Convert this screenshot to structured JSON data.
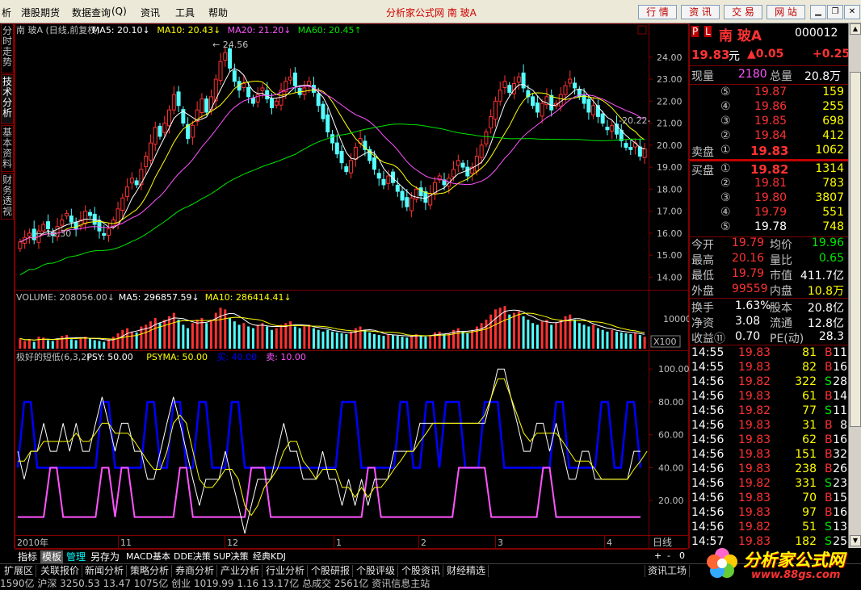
{
  "menu": {
    "items": [
      "析",
      "港股期货",
      "数据查询",
      "资讯",
      "工具",
      "帮助"
    ],
    "shortcut": "(Q)",
    "title": "分析家公式网 南 玻A",
    "right_buttons": [
      "行 情",
      "资 讯",
      "交 易",
      "网 站"
    ]
  },
  "side_tabs": [
    "分时走势",
    "技术分析",
    "基本资料",
    "财务透视"
  ],
  "price_panel": {
    "legend": [
      {
        "text": "南 玻A (日线,前复权)",
        "color": "#c0c0c0"
      },
      {
        "text": "MA5: 20.10↓",
        "color": "#ffffff"
      },
      {
        "text": "MA10: 20.43↓",
        "color": "#ffff00"
      },
      {
        "text": "MA20: 21.20↓",
        "color": "#ff54ff"
      },
      {
        "text": "MA60: 20.45↑",
        "color": "#00e600"
      }
    ],
    "y_ticks": [
      "24.00",
      "23.00",
      "22.00",
      "21.00",
      "20.00",
      "19.00",
      "18.00",
      "17.00",
      "16.00",
      "15.00",
      "14.00"
    ],
    "high_label": "24.56",
    "low_label": "15.30",
    "last_label": "20.22"
  },
  "volume_panel": {
    "legend": [
      {
        "text": "VOLUME: 208056.00↓",
        "color": "#c0c0c0"
      },
      {
        "text": "MA5: 296857.59↓",
        "color": "#ffffff"
      },
      {
        "text": "MA10: 286414.41↓",
        "color": "#ffff00"
      }
    ],
    "y_tick": "10000",
    "unit": "X100"
  },
  "indicator_panel": {
    "legend": [
      {
        "text": "极好的短低(6,3,2)",
        "color": "#c0c0c0"
      },
      {
        "text": "PSY: 50.00",
        "color": "#ffffff"
      },
      {
        "text": "PSYMA: 50.00",
        "color": "#ffff00"
      },
      {
        "text": "买: 40.00",
        "color": "#0000ff"
      },
      {
        "text": "卖: 10.00",
        "color": "#ff54ff"
      }
    ],
    "y_ticks": [
      "100.00",
      "80.00",
      "60.00",
      "40.00",
      "20.00"
    ]
  },
  "x_axis": {
    "labels": [
      "2010年",
      "11",
      "12",
      "1",
      "2",
      "3",
      "4"
    ],
    "period": "日线"
  },
  "chart_data": [
    {
      "type": "candlestick",
      "title": "南 玻A (日线,前复权)",
      "ylim": [
        13.5,
        24.8
      ],
      "high": 24.56,
      "low": 15.3,
      "series": [
        {
          "name": "MA5",
          "last": 20.1
        },
        {
          "name": "MA10",
          "last": 20.43
        },
        {
          "name": "MA20",
          "last": 21.2
        },
        {
          "name": "MA60",
          "last": 20.45
        }
      ],
      "close": [
        15.6,
        15.8,
        16.0,
        15.7,
        16.1,
        16.4,
        16.2,
        15.9,
        16.3,
        16.6,
        16.9,
        16.5,
        16.2,
        16.6,
        17.0,
        16.8,
        16.4,
        16.1,
        15.9,
        16.2,
        16.6,
        17.1,
        17.6,
        18.1,
        18.5,
        18.2,
        18.9,
        19.5,
        20.1,
        20.8,
        20.4,
        21.0,
        21.6,
        22.3,
        21.8,
        21.0,
        20.3,
        20.9,
        21.6,
        22.1,
        21.5,
        22.2,
        23.0,
        23.8,
        24.2,
        23.5,
        22.9,
        22.5,
        22.8,
        22.2,
        21.9,
        22.3,
        22.6,
        22.1,
        21.7,
        22.0,
        22.5,
        22.9,
        23.1,
        22.7,
        22.3,
        22.6,
        22.9,
        22.4,
        21.8,
        21.2,
        20.6,
        20.1,
        19.6,
        19.2,
        18.8,
        19.3,
        19.9,
        20.3,
        19.8,
        19.3,
        18.9,
        18.5,
        18.2,
        18.6,
        18.3,
        17.9,
        17.5,
        17.2,
        17.6,
        18.0,
        17.7,
        17.4,
        17.8,
        18.3,
        18.6,
        18.2,
        18.5,
        18.9,
        19.3,
        19.0,
        18.6,
        19.0,
        19.5,
        20.0,
        20.6,
        21.3,
        22.0,
        22.5,
        22.9,
        22.4,
        22.8,
        23.1,
        22.6,
        22.2,
        21.8,
        21.5,
        21.9,
        22.2,
        21.6,
        21.9,
        22.3,
        22.7,
        23.0,
        22.6,
        22.2,
        21.9,
        21.5,
        21.8,
        21.3,
        21.0,
        20.7,
        20.9,
        20.5,
        20.2,
        19.9,
        19.8,
        20.1,
        19.5,
        19.83
      ]
    },
    {
      "type": "bar",
      "title": "VOLUME",
      "value": 208056.0,
      "series": [
        {
          "name": "MA5",
          "last": 296857.59
        },
        {
          "name": "MA10",
          "last": 286414.41
        }
      ],
      "values": [
        60,
        45,
        55,
        40,
        70,
        65,
        50,
        45,
        60,
        75,
        80,
        55,
        50,
        65,
        70,
        60,
        50,
        45,
        40,
        55,
        70,
        90,
        110,
        120,
        100,
        95,
        130,
        140,
        160,
        180,
        150,
        170,
        190,
        210,
        170,
        140,
        120,
        150,
        170,
        180,
        150,
        170,
        210,
        240,
        230,
        180,
        160,
        140,
        150,
        130,
        120,
        140,
        150,
        130,
        110,
        120,
        140,
        150,
        160,
        130,
        120,
        130,
        140,
        120,
        110,
        100,
        110,
        100,
        95,
        90,
        85,
        100,
        120,
        130,
        110,
        95,
        85,
        80,
        75,
        85,
        80,
        75,
        70,
        65,
        75,
        85,
        75,
        70,
        80,
        95,
        100,
        85,
        90,
        110,
        120,
        100,
        90,
        110,
        130,
        150,
        170,
        200,
        230,
        240,
        250,
        200,
        210,
        220,
        190,
        170,
        150,
        140,
        160,
        170,
        140,
        150,
        170,
        190,
        200,
        170,
        150,
        140,
        130,
        140,
        120,
        110,
        100,
        110,
        100,
        95,
        90,
        85,
        95,
        80,
        70
      ],
      "unit": "X100"
    },
    {
      "type": "line",
      "title": "极好的短低(6,3,2)",
      "ylim": [
        0,
        105
      ],
      "series": [
        {
          "name": "PSY",
          "last": 50.0
        },
        {
          "name": "PSYMA",
          "last": 50.0
        },
        {
          "name": "买",
          "last": 40.0
        },
        {
          "name": "卖",
          "last": 10.0
        }
      ],
      "psy": [
        50,
        33,
        50,
        50,
        67,
        50,
        50,
        67,
        50,
        67,
        50,
        50,
        67,
        83,
        67,
        50,
        67,
        67,
        50,
        50,
        33,
        33,
        50,
        67,
        83,
        67,
        50,
        33,
        17,
        33,
        33,
        33,
        50,
        33,
        17,
        0,
        17,
        33,
        33,
        33,
        50,
        67,
        50,
        50,
        33,
        33,
        33,
        50,
        33,
        33,
        17,
        33,
        17,
        33,
        17,
        33,
        33,
        33,
        50,
        50,
        50,
        50,
        67,
        67,
        67,
        67,
        67,
        67,
        67,
        67,
        67,
        67,
        67,
        83,
        100,
        100,
        83,
        67,
        50,
        50,
        67,
        67,
        50,
        67,
        50,
        33,
        33,
        50,
        50,
        33,
        33,
        33,
        33,
        33,
        33,
        50,
        50
      ],
      "psyma": [
        44,
        44,
        50,
        50,
        56,
        56,
        56,
        56,
        56,
        61,
        56,
        56,
        61,
        67,
        67,
        61,
        61,
        61,
        56,
        50,
        44,
        39,
        39,
        50,
        67,
        72,
        67,
        50,
        33,
        28,
        28,
        33,
        39,
        39,
        33,
        17,
        11,
        17,
        28,
        33,
        39,
        50,
        56,
        56,
        44,
        39,
        33,
        39,
        39,
        39,
        28,
        28,
        22,
        28,
        22,
        28,
        28,
        33,
        39,
        44,
        50,
        50,
        56,
        61,
        67,
        67,
        67,
        67,
        67,
        67,
        67,
        67,
        72,
        83,
        94,
        94,
        83,
        72,
        61,
        56,
        61,
        61,
        61,
        61,
        56,
        50,
        44,
        44,
        44,
        39,
        33,
        33,
        33,
        33,
        33,
        39,
        44,
        50
      ]
    }
  ],
  "right_panel": {
    "stock_name": "南 玻A",
    "code": "000012",
    "price": "19.83",
    "price_unit": "元",
    "change": "▲0.05",
    "change_pct": "+0.25",
    "volume": {
      "label1": "现量",
      "val1": "2180",
      "label2": "总量",
      "val2": "20.8万"
    },
    "sells": [
      {
        "n": "⑤",
        "p": "19.87",
        "v": "159"
      },
      {
        "n": "④",
        "p": "19.86",
        "v": "255"
      },
      {
        "n": "③",
        "p": "19.85",
        "v": "698"
      },
      {
        "n": "②",
        "p": "19.84",
        "v": "412"
      }
    ],
    "sell1": {
      "label": "卖盘",
      "n": "①",
      "p": "19.83",
      "v": "1062"
    },
    "buy1": {
      "label": "买盘",
      "n": "①",
      "p": "19.82",
      "v": "1314"
    },
    "buys": [
      {
        "n": "②",
        "p": "19.81",
        "v": "783"
      },
      {
        "n": "③",
        "p": "19.80",
        "v": "3807"
      },
      {
        "n": "④",
        "p": "19.79",
        "v": "551"
      },
      {
        "n": "⑤",
        "p": "19.78",
        "v": "748"
      }
    ],
    "stats": [
      {
        "l1": "今开",
        "v1": "19.79",
        "l2": "均价",
        "v2": "19.96"
      },
      {
        "l1": "最高",
        "v1": "20.16",
        "l2": "量比",
        "v2": "0.65"
      },
      {
        "l1": "最低",
        "v1": "19.79",
        "l2": "市值",
        "v2": "411.7亿"
      },
      {
        "l1": "外盘",
        "v1": "99559",
        "l2": "内盘",
        "v2": "10.8万"
      }
    ],
    "fund": [
      {
        "l1": "换手",
        "v1": "1.63%",
        "l2": "股本",
        "v2": "20.8亿"
      },
      {
        "l1": "净资",
        "v1": "3.08",
        "l2": "流通",
        "v2": "12.8亿"
      },
      {
        "l1": "收益⑪",
        "v1": "0.70",
        "l2": "PE(动)",
        "v2": "28.3"
      }
    ],
    "ticks": [
      {
        "t": "14:55",
        "p": "19.83",
        "v": "81",
        "bs": "B",
        "n": "11"
      },
      {
        "t": "14:55",
        "p": "19.83",
        "v": "82",
        "bs": "B",
        "n": "16"
      },
      {
        "t": "14:56",
        "p": "19.82",
        "v": "322",
        "bs": "S",
        "n": "28"
      },
      {
        "t": "14:56",
        "p": "19.83",
        "v": "61",
        "bs": "B",
        "n": "14"
      },
      {
        "t": "14:56",
        "p": "19.82",
        "v": "77",
        "bs": "S",
        "n": "11"
      },
      {
        "t": "14:56",
        "p": "19.83",
        "v": "31",
        "bs": "B",
        "n": "8"
      },
      {
        "t": "14:56",
        "p": "19.83",
        "v": "62",
        "bs": "B",
        "n": "16"
      },
      {
        "t": "14:56",
        "p": "19.83",
        "v": "151",
        "bs": "B",
        "n": "32"
      },
      {
        "t": "14:56",
        "p": "19.83",
        "v": "238",
        "bs": "B",
        "n": "26"
      },
      {
        "t": "14:56",
        "p": "19.82",
        "v": "331",
        "bs": "S",
        "n": "23"
      },
      {
        "t": "14:56",
        "p": "19.83",
        "v": "70",
        "bs": "B",
        "n": "15"
      },
      {
        "t": "14:56",
        "p": "19.83",
        "v": "97",
        "bs": "B",
        "n": "16"
      },
      {
        "t": "14:56",
        "p": "19.82",
        "v": "51",
        "bs": "S",
        "n": "13"
      },
      {
        "t": "14:57",
        "p": "19.83",
        "v": "182",
        "bs": "S",
        "n": "25"
      }
    ]
  },
  "tabs": [
    "指标",
    "模板",
    "管理",
    "另存为",
    "MACD基本",
    "DDE决策",
    "SUP决策",
    "经典KDJ"
  ],
  "bottom_nav": [
    "扩展区",
    "关联报价",
    "新闻分析",
    "策略分析",
    "券商分析",
    "产业分析",
    "行业分析",
    "个股研报",
    "个股评级",
    "个股资讯",
    "财经精选"
  ],
  "bottom_right": "资讯工场",
  "ticker": "1590亿  沪深 3250.53  13.47  1075亿  创业 1019.99  1.16  13.17亿  总成交  2561亿  资讯信息主站",
  "logo": {
    "text": "分析家公式网",
    "url": "www.88gs.com"
  },
  "colors": {
    "up": "#ff3232",
    "down": "#54ffff",
    "ma5": "#ffffff",
    "ma10": "#ffff00",
    "ma20": "#ff54ff",
    "ma60": "#00e600",
    "buy": "#0000ff",
    "sell": "#ff54ff",
    "frame": "#800000"
  }
}
